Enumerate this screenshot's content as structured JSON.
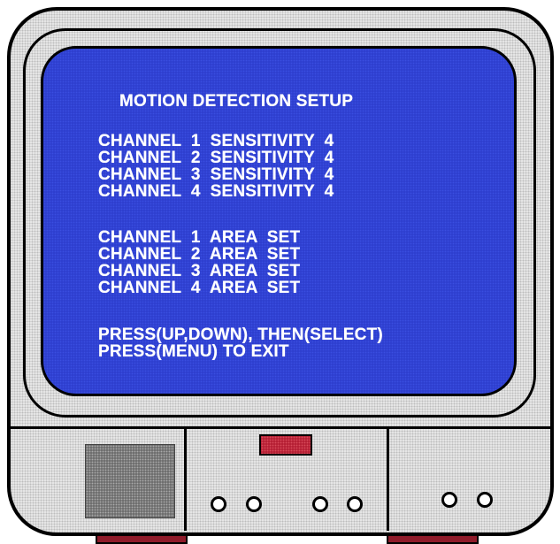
{
  "screen": {
    "title": "MOTION DETECTION SETUP",
    "sensitivity_lines": [
      "CHANNEL  1  SENSITIVITY  4",
      "CHANNEL  2  SENSITIVITY  4",
      "CHANNEL  3  SENSITIVITY  4",
      "CHANNEL  4  SENSITIVITY  4"
    ],
    "area_lines": [
      "CHANNEL  1  AREA  SET",
      "CHANNEL  2  AREA  SET",
      "CHANNEL  3  AREA  SET",
      "CHANNEL  4  AREA  SET"
    ],
    "instructions": [
      "PRESS(UP,DOWN), THEN(SELECT)",
      "PRESS(MENU) TO EXIT"
    ]
  },
  "colors": {
    "screen": "#2e3fcf",
    "led": "#b62035",
    "feet": "#8f1b2a",
    "body": "#e6e6e6"
  }
}
